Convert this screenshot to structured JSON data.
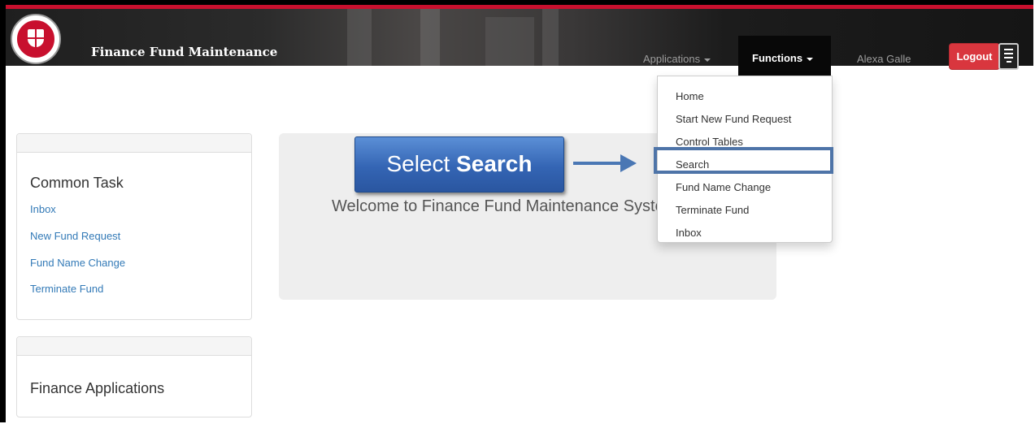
{
  "header": {
    "app_title": "Finance Fund Maintenance",
    "applications_label": "Applications",
    "functions_label": "Functions",
    "user_name": "Alexa Galle",
    "logout_label": "Logout",
    "accent_color": "#c8102e",
    "logo": "texas-tech-university-system-seal"
  },
  "functions_menu": {
    "items": [
      "Home",
      "Start New Fund Request",
      "Control Tables",
      "Search",
      "Fund Name Change",
      "Terminate Fund",
      "Inbox"
    ],
    "highlighted_item": "Search"
  },
  "sidebar": {
    "common_task": {
      "title": "Common Task",
      "links": [
        "Inbox",
        "New Fund Request",
        "Fund Name Change",
        "Terminate Fund"
      ]
    },
    "finance_applications": {
      "title": "Finance Applications"
    }
  },
  "main": {
    "welcome_text": "Welcome to Finance Fund Maintenance System."
  },
  "callout": {
    "prefix": "Select",
    "emphasis": "Search"
  }
}
